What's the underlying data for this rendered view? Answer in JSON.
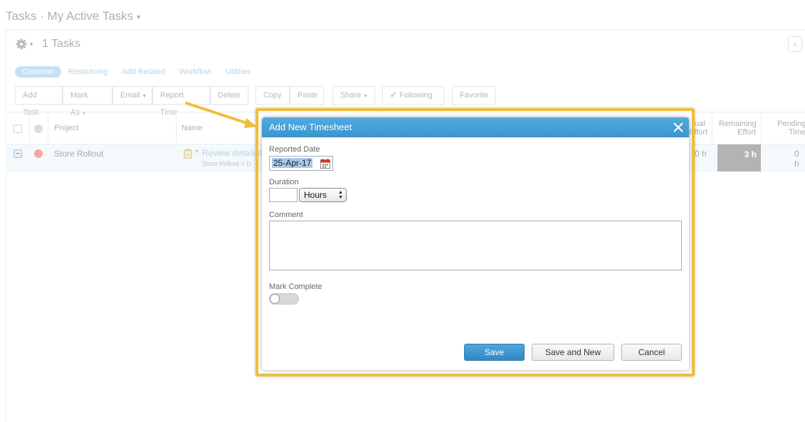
{
  "page": {
    "title": "Tasks · My Active Tasks",
    "task_count": "1 Tasks"
  },
  "subtabs": [
    "Common",
    "Resourcing",
    "Add Related",
    "Workflow",
    "Utilities"
  ],
  "toolbar": {
    "add_task": "Add Task",
    "mark_as": "Mark As",
    "email": "Email",
    "report_time": "Report Time",
    "delete": "Delete",
    "copy": "Copy",
    "paste": "Paste",
    "share": "Share",
    "following": "Following",
    "favorite": "Favorite"
  },
  "grid": {
    "headers": {
      "project": "Project",
      "name": "Name",
      "actual_effort_line1": "ual",
      "actual_effort_line2": "Effort",
      "remaining_line1": "Remaining",
      "remaining_line2": "Effort",
      "pending_line1": "Pending",
      "pending_line2": "Time"
    },
    "row": {
      "project": "Store Rollout",
      "task_name": "Review detailed",
      "task_path": "Store Rollout > D",
      "actual_effort": "0 h",
      "remaining_effort": "3 h",
      "pending_time": "0 h"
    }
  },
  "dialog": {
    "title": "Add New Timesheet",
    "reported_date_label": "Reported Date",
    "reported_date_value": "25-Apr-17",
    "duration_label": "Duration",
    "duration_value": "",
    "duration_unit": "Hours",
    "comment_label": "Comment",
    "comment_value": "",
    "mark_complete_label": "Mark Complete",
    "mark_complete_on": false,
    "save": "Save",
    "save_and_new": "Save and New",
    "cancel": "Cancel"
  },
  "colors": {
    "header_blue": "#3c94cc",
    "highlight": "#eebe3b",
    "save_button": "#3388c4"
  }
}
